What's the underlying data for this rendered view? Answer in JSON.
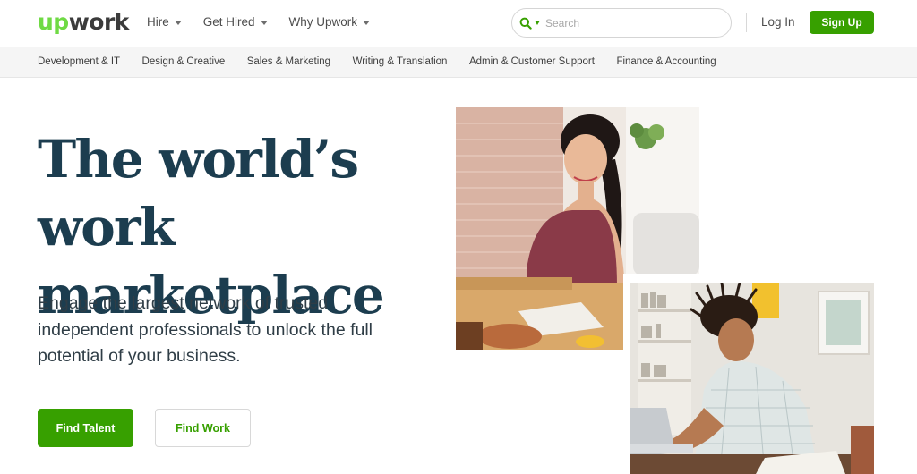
{
  "header": {
    "logo_up": "up",
    "logo_rest": "work",
    "nav": [
      {
        "label": "Hire"
      },
      {
        "label": "Get Hired"
      },
      {
        "label": "Why Upwork"
      }
    ],
    "search": {
      "placeholder": "Search",
      "value": ""
    },
    "login_label": "Log In",
    "signup_label": "Sign Up"
  },
  "categories": [
    "Development & IT",
    "Design & Creative",
    "Sales & Marketing",
    "Writing & Translation",
    "Admin & Customer Support",
    "Finance & Accounting"
  ],
  "hero": {
    "title_line1": "The world’s work",
    "title_line2": "marketplace",
    "subtitle": "Engage the largest network of trusted independent professionals to unlock the full potential of your business.",
    "find_talent_label": "Find Talent",
    "find_work_label": "Find Work"
  },
  "colors": {
    "brand_green": "#37a000",
    "logo_green": "#6fda44",
    "title_navy": "#1c3d4f"
  },
  "icons": {
    "search": "search-icon",
    "caret": "chevron-down-icon"
  }
}
